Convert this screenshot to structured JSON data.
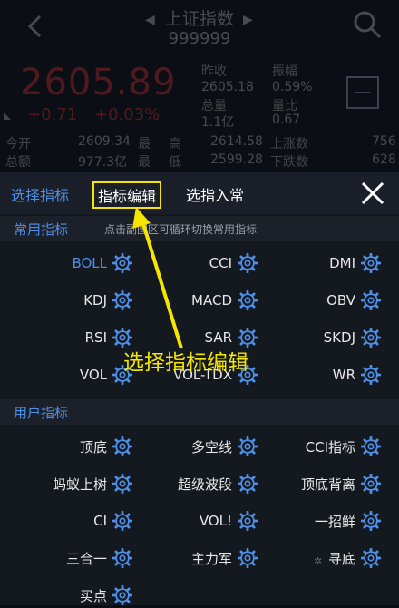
{
  "header": {
    "title": "上证指数",
    "code": "999999",
    "price": "2605.89",
    "change": "+0.71",
    "change_pct": "+0.03%",
    "stats": [
      {
        "label": "昨收",
        "value": "2605.18"
      },
      {
        "label": "振幅",
        "value": "0.59%"
      },
      {
        "label": "总量",
        "value": "1.1亿"
      },
      {
        "label": "量比",
        "value": "0.67"
      }
    ],
    "rows": [
      {
        "l1": "今开",
        "v1": "2609.34",
        "l2": "最",
        "l3": "高",
        "v2": "2614.58",
        "l4": "上涨数",
        "v3": "756"
      },
      {
        "l1": "总额",
        "v1": "977.3亿",
        "l2": "最",
        "l3": "低",
        "v2": "2599.28",
        "l4": "下跌数",
        "v3": "628"
      }
    ]
  },
  "tabs": {
    "select_indicator": "选择指标",
    "edit_indicator": "指标编辑",
    "select_regular": "选指入常"
  },
  "common_section": {
    "title": "常用指标",
    "hint": "点击副图区可循环切换常用指标",
    "items": [
      "BOLL",
      "CCI",
      "DMI",
      "KDJ",
      "MACD",
      "OBV",
      "RSI",
      "SAR",
      "SKDJ",
      "VOL",
      "VOL-TDX",
      "WR"
    ]
  },
  "user_section": {
    "title": "用户指标",
    "items": [
      "顶底",
      "多空线",
      "CCI指标",
      "蚂蚁上树",
      "超级波段",
      "顶底背离",
      "CI",
      "VOL!",
      "一招鲜",
      "三合一",
      "主力军",
      "寻底",
      "买点"
    ]
  },
  "annotation": {
    "text": "选择指标编辑"
  },
  "colors": {
    "accent_blue": "#4e8fe8",
    "price_red": "#ff3a3a",
    "annotation_yellow": "#f5e500"
  },
  "icons": {
    "gear": "gear-icon",
    "close": "close-icon",
    "back": "chevron-left-icon",
    "search": "search-icon"
  }
}
